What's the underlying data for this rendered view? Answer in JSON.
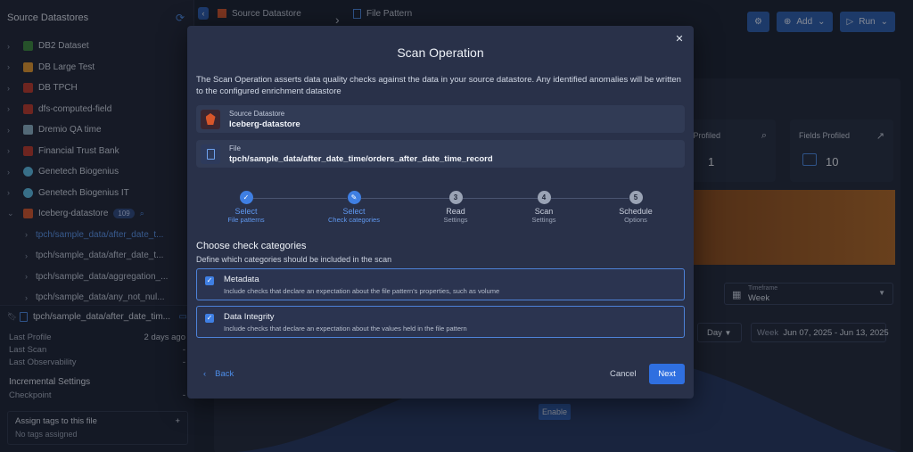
{
  "sidebar": {
    "title": "Source Datastores",
    "items": [
      {
        "label": "DB2 Dataset",
        "color": "#3d8a3d"
      },
      {
        "label": "DB Large Test",
        "color": "#e89a2c"
      },
      {
        "label": "DB TPCH",
        "color": "#c0392b"
      },
      {
        "label": "dfs-computed-field",
        "color": "#c0392b"
      },
      {
        "label": "Dremio QA time",
        "color": "#8fb5c9"
      },
      {
        "label": "Financial Trust Bank",
        "color": "#c0392b"
      },
      {
        "label": "Genetech Biogenius",
        "color": "#5dc0e8"
      },
      {
        "label": "Genetech Biogenius IT",
        "color": "#5dc0e8"
      },
      {
        "label": "Iceberg-datastore",
        "color": "#d7562a",
        "count": "109"
      }
    ],
    "sub_items": [
      {
        "label": "tpch/sample_data/after_date_t..."
      },
      {
        "label": "tpch/sample_data/after_date_t..."
      },
      {
        "label": "tpch/sample_data/aggregation_..."
      },
      {
        "label": "tpch/sample_data/any_not_nul..."
      }
    ],
    "selected_file": "tpch/sample_data/after_date_tim...",
    "meta": [
      {
        "label": "Last Profile",
        "value": "2 days ago"
      },
      {
        "label": "Last Scan",
        "value": "-"
      },
      {
        "label": "Last Observability",
        "value": "-"
      }
    ],
    "incremental_title": "Incremental Settings",
    "checkpoint_label": "Checkpoint",
    "checkpoint_value": "-",
    "tags_title": "Assign tags to this file",
    "tags_empty": "No tags assigned",
    "tags_add": "+"
  },
  "topbar": {
    "crumb1_title": "Source Datastore",
    "crumb2_title": "File Pattern",
    "add_label": "Add",
    "run_label": "Run"
  },
  "background": {
    "files_profiled_label": "e Profiled",
    "files_profiled_value": "1",
    "fields_profiled_label": "Fields Profiled",
    "fields_profiled_value": "10",
    "timeframe_label": "Timeframe",
    "timeframe_value": "Week",
    "day_value": "Day",
    "week_label": "Week",
    "week_range": "Jun 07, 2025 - Jun 13, 2025",
    "enable_label": "Enable"
  },
  "modal": {
    "title": "Scan Operation",
    "description": "The Scan Operation asserts data quality checks against the data in your source datastore. Any identified anomalies will be written to the configured enrichment datastore",
    "source_label": "Source Datastore",
    "source_value": "Iceberg-datastore",
    "file_label": "File",
    "file_value": "tpch/sample_data/after_date_time/orders_after_date_time_record",
    "steps": [
      {
        "num": "✓",
        "title": "Select",
        "sub": "File patterns",
        "state": "done"
      },
      {
        "num": "✎",
        "title": "Select",
        "sub": "Check categories",
        "state": "active"
      },
      {
        "num": "3",
        "title": "Read",
        "sub": "Settings",
        "state": "todo"
      },
      {
        "num": "4",
        "title": "Scan",
        "sub": "Settings",
        "state": "todo"
      },
      {
        "num": "5",
        "title": "Schedule",
        "sub": "Options",
        "state": "todo"
      }
    ],
    "section_title": "Choose check categories",
    "section_sub": "Define which categories should be included in the scan",
    "categories": [
      {
        "title": "Metadata",
        "desc": "Include checks that declare an expectation about the file pattern's properties, such as volume",
        "checked": true
      },
      {
        "title": "Data Integrity",
        "desc": "Include checks that declare an expectation about the values held in the file pattern",
        "checked": true
      }
    ],
    "back_label": "Back",
    "cancel_label": "Cancel",
    "next_label": "Next"
  },
  "colors": {
    "accent": "#3f7fe3",
    "modal_bg": "#293149",
    "page_bg": "#1b2130"
  }
}
